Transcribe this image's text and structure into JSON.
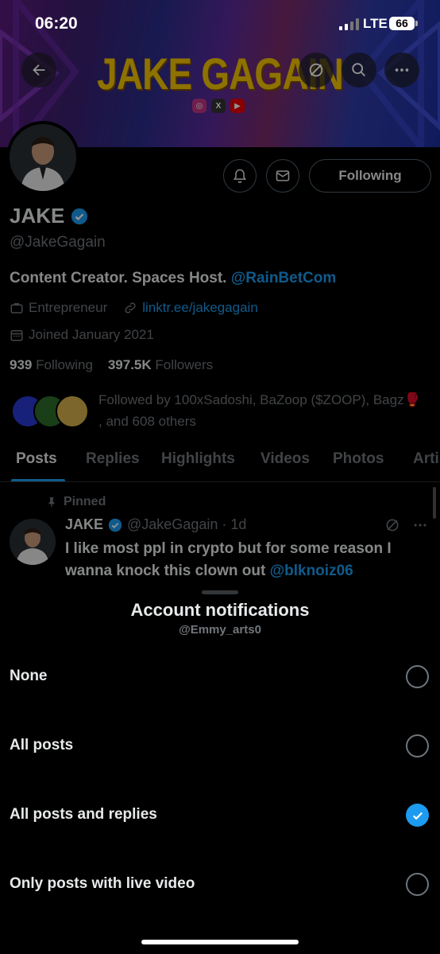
{
  "status_bar": {
    "time": "06:20",
    "network": "LTE",
    "battery": "66"
  },
  "banner": {
    "title": "JAKE GAGAIN",
    "socials": [
      "instagram-icon",
      "x-icon",
      "youtube-icon"
    ]
  },
  "profile": {
    "name": "JAKE",
    "handle": "@JakeGagain",
    "bio_text": "Content Creator. Spaces Host. ",
    "bio_mention": "@RainBetCom",
    "category": "Entrepreneur",
    "website": "linktr.ee/jakegagain",
    "joined": "Joined January 2021",
    "following_count": "939",
    "following_label": "Following",
    "followers_count": "397.5K",
    "followers_label": "Followers",
    "followed_by": "Followed by 100xSadoshi, BaZoop ($ZOOP), Bagz🥊 , and 608 others",
    "follow_button": "Following"
  },
  "tabs": [
    "Posts",
    "Replies",
    "Highlights",
    "Videos",
    "Photos",
    "Arti"
  ],
  "active_tab": "Posts",
  "pinned_post": {
    "pinned_label": "Pinned",
    "author": "JAKE",
    "handle_time": "@JakeGagain · 1d",
    "text": "I like most ppl in crypto but for some reason I wanna knock this clown out ",
    "mention": "@blknoiz06"
  },
  "sheet": {
    "title": "Account notifications",
    "subtitle": "@Emmy_arts0",
    "options": [
      {
        "label": "None",
        "selected": false
      },
      {
        "label": "All posts",
        "selected": false
      },
      {
        "label": "All posts and replies",
        "selected": true
      },
      {
        "label": "Only posts with live video",
        "selected": false
      }
    ]
  },
  "colors": {
    "accent": "#1d9bf0",
    "banner_title": "#f4c400",
    "background": "#000000"
  }
}
